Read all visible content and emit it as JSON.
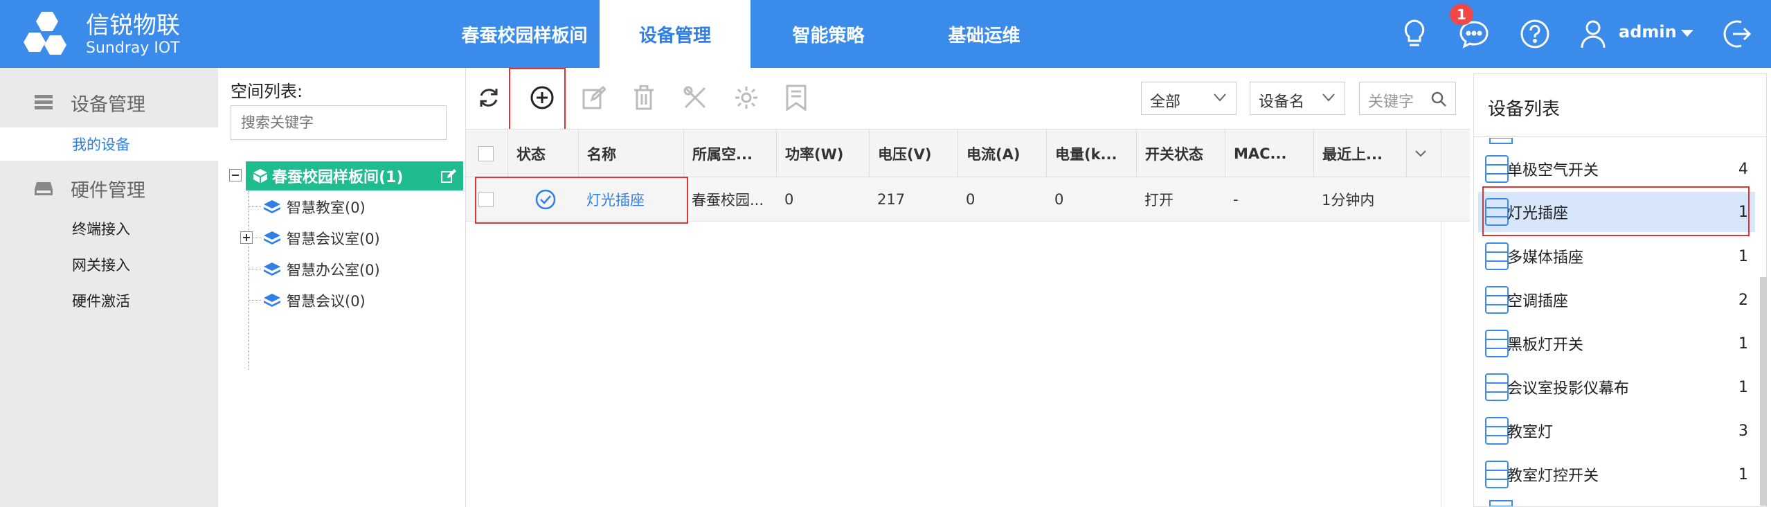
{
  "app": {
    "logo_cn": "信锐物联",
    "logo_en": "Sundray IOT"
  },
  "nav": {
    "tabs": [
      {
        "label": "春蚕校园样板间"
      },
      {
        "label": "设备管理"
      },
      {
        "label": "智能策略"
      },
      {
        "label": "基础运维"
      }
    ],
    "active_tab": "设备管理",
    "message_badge": "1",
    "user": "admin"
  },
  "sidebar": {
    "group1": "设备管理",
    "group1_items": [
      "我的设备"
    ],
    "group2": "硬件管理",
    "group2_items": [
      "终端接入",
      "网关接入",
      "硬件激活"
    ],
    "active_item": "我的设备"
  },
  "space": {
    "title": "空间列表:",
    "search_placeholder": "搜索关键字",
    "root": "春蚕校园样板间(1)",
    "children": [
      "智慧教室(0)",
      "智慧会议室(0)",
      "智慧办公室(0)",
      "智慧会议(0)"
    ]
  },
  "toolbar": {
    "filter_all": "全部",
    "filter_field": "设备名",
    "keyword_placeholder": "关键字"
  },
  "table": {
    "headers": [
      "状态",
      "名称",
      "所属空...",
      "功率(W)",
      "电压(V)",
      "电流(A)",
      "电量(k...",
      "开关状态",
      "MAC...",
      "最近上..."
    ],
    "rows": [
      {
        "name": "灯光插座",
        "space": "春蚕校园...",
        "power": "0",
        "voltage": "217",
        "current": "0",
        "energy": "0",
        "switch": "打开",
        "mac": "-",
        "last": "1分钟内"
      }
    ]
  },
  "device_list": {
    "title": "设备列表",
    "items": [
      {
        "name": "单极空气开关",
        "count": "4"
      },
      {
        "name": "灯光插座",
        "count": "1"
      },
      {
        "name": "多媒体插座",
        "count": "1"
      },
      {
        "name": "空调插座",
        "count": "2"
      },
      {
        "name": "黑板灯开关",
        "count": "1"
      },
      {
        "name": "会议室投影仪幕布",
        "count": "1"
      },
      {
        "name": "教室灯",
        "count": "3"
      },
      {
        "name": "教室灯控开关",
        "count": "1"
      }
    ]
  },
  "colors": {
    "primary": "#3b8beb",
    "tree_root": "#1fbc8f",
    "highlight_box": "#e03434",
    "link": "#2f7fe6"
  }
}
